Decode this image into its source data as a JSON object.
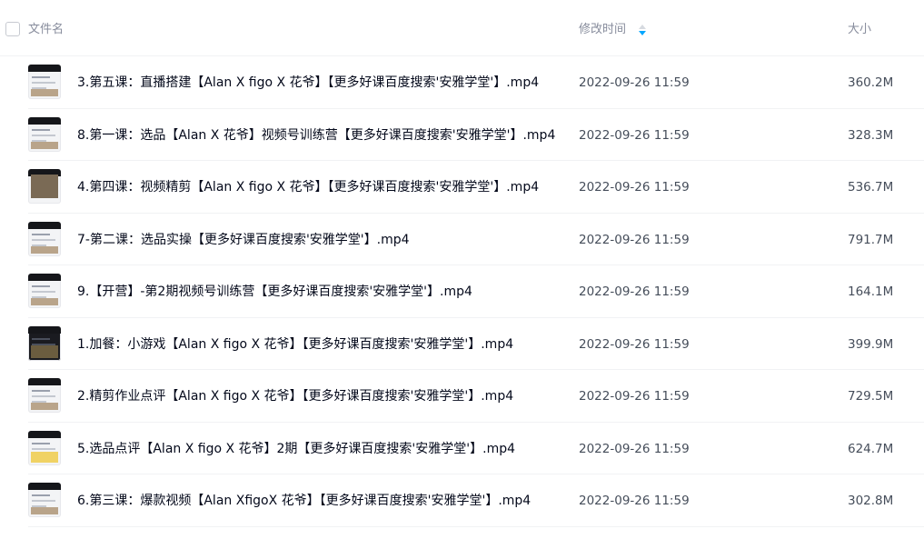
{
  "header": {
    "name_label": "文件名",
    "time_label": "修改时间",
    "size_label": "大小",
    "sort_icon": "sort-arrows-icon",
    "accent_color": "#06a7ff"
  },
  "files": [
    {
      "name": "3.第五课：直播搭建【Alan X figo X 花爷】【更多好课百度搜索'安雅学堂'】.mp4",
      "modified": "2022-09-26 11:59",
      "size": "360.2M",
      "thumb": "light"
    },
    {
      "name": "8.第一课：选品【Alan X 花爷】视频号训练营【更多好课百度搜索'安雅学堂'】.mp4",
      "modified": "2022-09-26 11:59",
      "size": "328.3M",
      "thumb": "light"
    },
    {
      "name": "4.第四课：视频精剪【Alan X figo X 花爷】【更多好课百度搜索'安雅学堂'】.mp4",
      "modified": "2022-09-26 11:59",
      "size": "536.7M",
      "thumb": "photo"
    },
    {
      "name": "7-第二课：选品实操【更多好课百度搜索'安雅学堂'】.mp4",
      "modified": "2022-09-26 11:59",
      "size": "791.7M",
      "thumb": "light"
    },
    {
      "name": "9.【开营】-第2期视频号训练营【更多好课百度搜索'安雅学堂'】.mp4",
      "modified": "2022-09-26 11:59",
      "size": "164.1M",
      "thumb": "light"
    },
    {
      "name": "1.加餐：小游戏【Alan X figo X 花爷】【更多好课百度搜索'安雅学堂'】.mp4",
      "modified": "2022-09-26 11:59",
      "size": "399.9M",
      "thumb": "dark"
    },
    {
      "name": "2.精剪作业点评【Alan X figo X 花爷】【更多好课百度搜索'安雅学堂'】.mp4",
      "modified": "2022-09-26 11:59",
      "size": "729.5M",
      "thumb": "light"
    },
    {
      "name": "5.选品点评【Alan X figo X 花爷】2期【更多好课百度搜索'安雅学堂'】.mp4",
      "modified": "2022-09-26 11:59",
      "size": "624.7M",
      "thumb": "yellow"
    },
    {
      "name": "6.第三课：爆款视频【Alan XfigoX 花爷】【更多好课百度搜索'安雅学堂'】.mp4",
      "modified": "2022-09-26 11:59",
      "size": "302.8M",
      "thumb": "light"
    }
  ]
}
